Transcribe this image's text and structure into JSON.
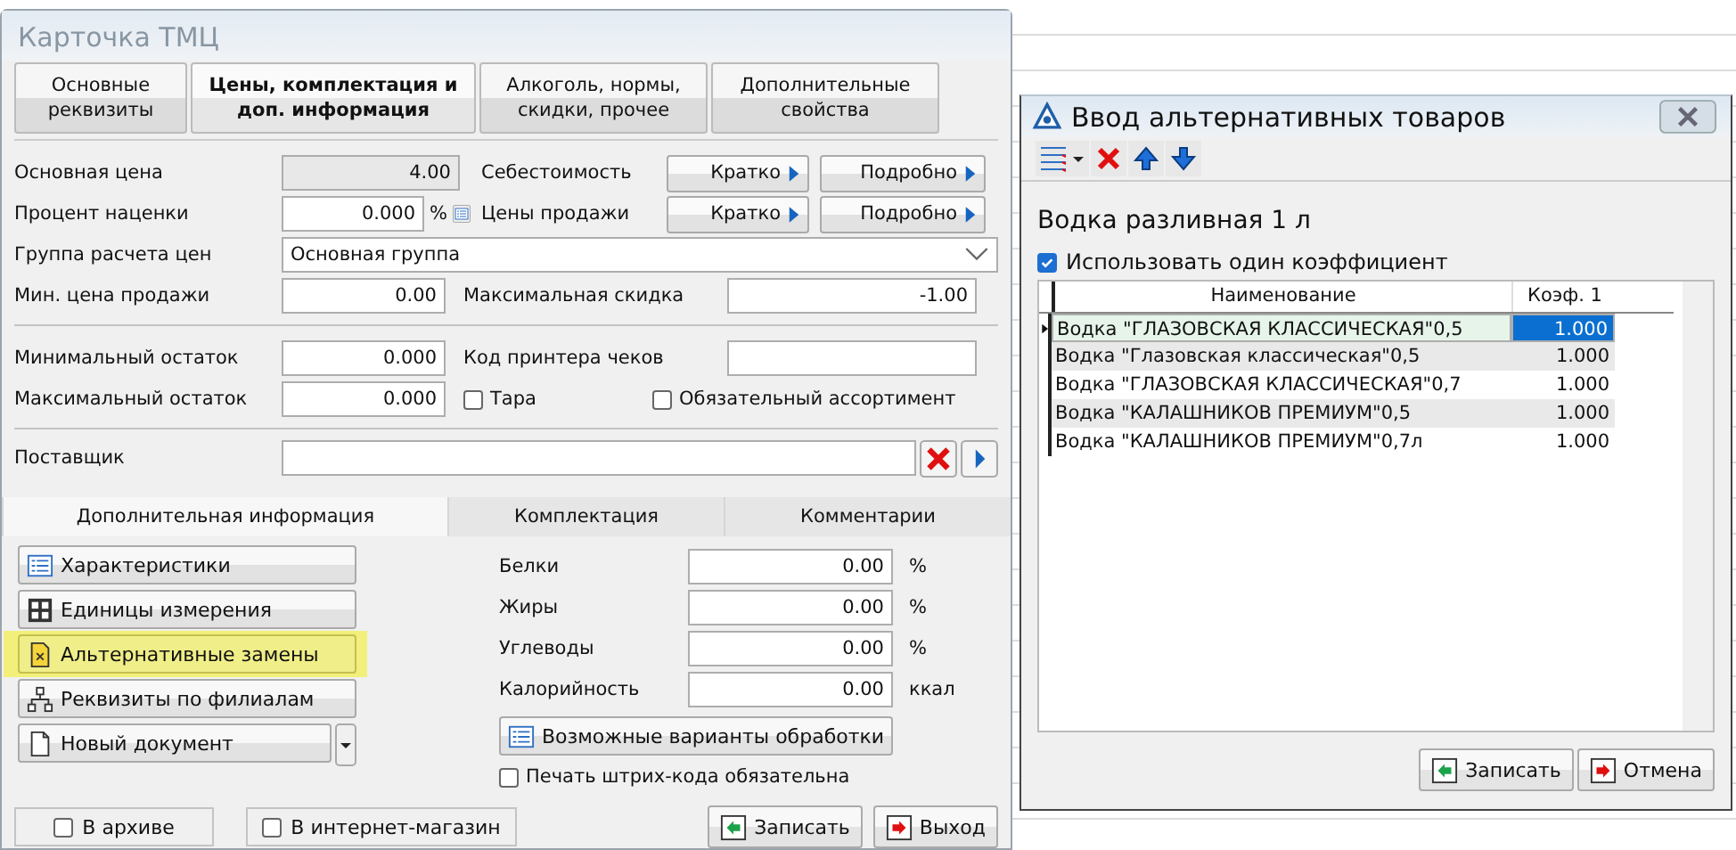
{
  "main_window": {
    "title": "Карточка ТМЦ",
    "tabs": [
      {
        "label": "Основные реквизиты",
        "selected": false
      },
      {
        "label": "Цены, комплектация и доп.  информация",
        "selected": true
      },
      {
        "label": "Алкоголь, нормы, скидки, прочее",
        "selected": false
      },
      {
        "label": "Дополнительные свойства",
        "selected": false
      }
    ],
    "base_price": {
      "label": "Основная цена",
      "value": "4.00",
      "disabled": true
    },
    "cost": {
      "label": "Себестоимость",
      "buttons": [
        "Кратко",
        "Подробно"
      ]
    },
    "markup": {
      "label": "Процент наценки",
      "value": "0.000",
      "unit": "%"
    },
    "sale_prices": {
      "label": "Цены продажи",
      "buttons": [
        "Кратко",
        "Подробно"
      ]
    },
    "price_group": {
      "label": "Группа расчета цен",
      "value": "Основная группа"
    },
    "min_price": {
      "label": "Мин. цена продажи",
      "value": "0.00"
    },
    "max_discount": {
      "label": "Максимальная скидка",
      "value": "-1.00"
    },
    "min_stock": {
      "label": "Минимальный остаток",
      "value": "0.000"
    },
    "printer_code": {
      "label": "Код принтера чеков"
    },
    "max_stock": {
      "label": "Максимальный остаток",
      "value": "0.000"
    },
    "tara": {
      "label": "Тара",
      "checked": false
    },
    "mandatory": {
      "label": "Обязательный ассортимент",
      "checked": false
    },
    "supplier": {
      "label": "Поставщик"
    },
    "lower_tabs": [
      {
        "label": "Дополнительная информация",
        "selected": true
      },
      {
        "label": "Комплектация",
        "selected": false
      },
      {
        "label": "Комментарии",
        "selected": false
      }
    ],
    "side_buttons": [
      {
        "label": "Характеристики",
        "kind": "list",
        "highlighted": false
      },
      {
        "label": "Единицы измерения",
        "kind": "units",
        "highlighted": false
      },
      {
        "label": "Альтернативные замены",
        "kind": "alt",
        "highlighted": true
      },
      {
        "label": "Реквизиты по филиалам",
        "kind": "branches",
        "highlighted": false
      },
      {
        "label": "Новый документ",
        "kind": "document",
        "highlighted": false
      }
    ],
    "nutrition": [
      {
        "label": "Белки",
        "value": "0.00",
        "unit": "%"
      },
      {
        "label": "Жиры",
        "value": "0.00",
        "unit": "%"
      },
      {
        "label": "Углеводы",
        "value": "0.00",
        "unit": "%"
      },
      {
        "label": "Калорийность",
        "value": "0.00",
        "unit": "ккал"
      }
    ],
    "processing_button": "Возможные варианты обработки",
    "barcode": {
      "label": "Печать штрих-кода обязательна",
      "checked": false
    },
    "bottom_checkboxes": [
      {
        "label": "В архиве",
        "checked": false
      },
      {
        "label": "В интернет-магазин",
        "checked": false
      }
    ],
    "actions": [
      {
        "label": "Записать",
        "kind": "save"
      },
      {
        "label": "Выход",
        "kind": "exit"
      }
    ]
  },
  "dialog": {
    "title": "Ввод альтернативных товаров",
    "product": "Водка разливная 1 л",
    "single_coef": {
      "label": "Использовать один коэффициент",
      "checked": true
    },
    "columns": [
      "Наименование",
      "Коэф. 1"
    ],
    "rows": [
      {
        "name": "Водка \"ГЛАЗОВСКАЯ КЛАССИЧЕСКАЯ\"0,5",
        "coef": "1.000",
        "selected": true
      },
      {
        "name": "Водка \"Глазовская классическая\"0,5",
        "coef": "1.000",
        "selected": false
      },
      {
        "name": "Водка \"ГЛАЗОВСКАЯ КЛАССИЧЕСКАЯ\"0,7",
        "coef": "1.000",
        "selected": false
      },
      {
        "name": "Водка \"КАЛАШНИКОВ ПРЕМИУМ\"0,5",
        "coef": "1.000",
        "selected": false
      },
      {
        "name": "Водка \"КАЛАШНИКОВ ПРЕМИУМ\"0,7л",
        "coef": "1.000",
        "selected": false
      }
    ],
    "buttons": [
      {
        "label": "Записать",
        "kind": "save"
      },
      {
        "label": "Отмена",
        "kind": "cancel"
      }
    ]
  }
}
